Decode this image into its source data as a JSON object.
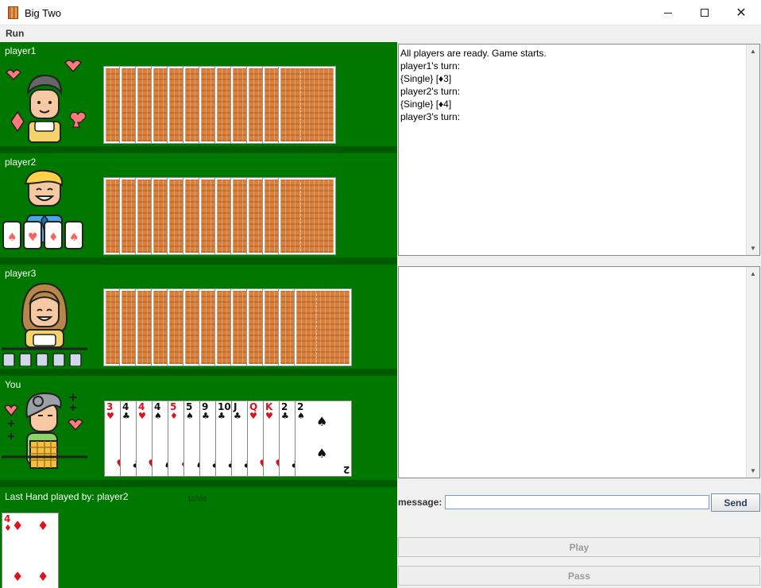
{
  "window": {
    "title": "Big Two",
    "icons": [
      "app-icon",
      "minimize-icon",
      "maximize-icon",
      "close-icon"
    ]
  },
  "menu": {
    "run": "Run"
  },
  "players": [
    {
      "name": "player1",
      "cards_in_hand": 12
    },
    {
      "name": "player2",
      "cards_in_hand": 12
    },
    {
      "name": "player3",
      "cards_in_hand": 13
    },
    {
      "name": "You"
    }
  ],
  "your_hand": [
    {
      "rank": "3",
      "suit": "♥",
      "color": "#e0101a"
    },
    {
      "rank": "4",
      "suit": "♣",
      "color": "#111111"
    },
    {
      "rank": "4",
      "suit": "♥",
      "color": "#e0101a"
    },
    {
      "rank": "4",
      "suit": "♠",
      "color": "#111111"
    },
    {
      "rank": "5",
      "suit": "♦",
      "color": "#e0101a"
    },
    {
      "rank": "5",
      "suit": "♠",
      "color": "#111111"
    },
    {
      "rank": "9",
      "suit": "♣",
      "color": "#111111"
    },
    {
      "rank": "10",
      "suit": "♣",
      "color": "#111111"
    },
    {
      "rank": "J",
      "suit": "♣",
      "color": "#111111"
    },
    {
      "rank": "Q",
      "suit": "♥",
      "color": "#e0101a"
    },
    {
      "rank": "K",
      "suit": "♥",
      "color": "#e0101a"
    },
    {
      "rank": "2",
      "suit": "♣",
      "color": "#111111"
    },
    {
      "rank": "2",
      "suit": "♠",
      "color": "#111111"
    }
  ],
  "table": {
    "last_hand_label": "Last Hand played by: player2",
    "label": "table",
    "last_card": {
      "rank": "4",
      "suit": "♦",
      "color": "#e0101a"
    }
  },
  "game_log": {
    "lines": [
      "All players are ready. Game starts.",
      "player1's turn:",
      "{Single} [♦3]",
      "player2's turn:",
      "{Single} [♦4]",
      "player3's turn:"
    ]
  },
  "chat": {
    "message_label": "message:",
    "message_value": "",
    "send_label": "Send"
  },
  "actions": {
    "play_label": "Play",
    "pass_label": "Pass"
  },
  "colors": {
    "table_green": "#007800",
    "separator_green": "#005a00",
    "card_back": "#d9803c"
  }
}
